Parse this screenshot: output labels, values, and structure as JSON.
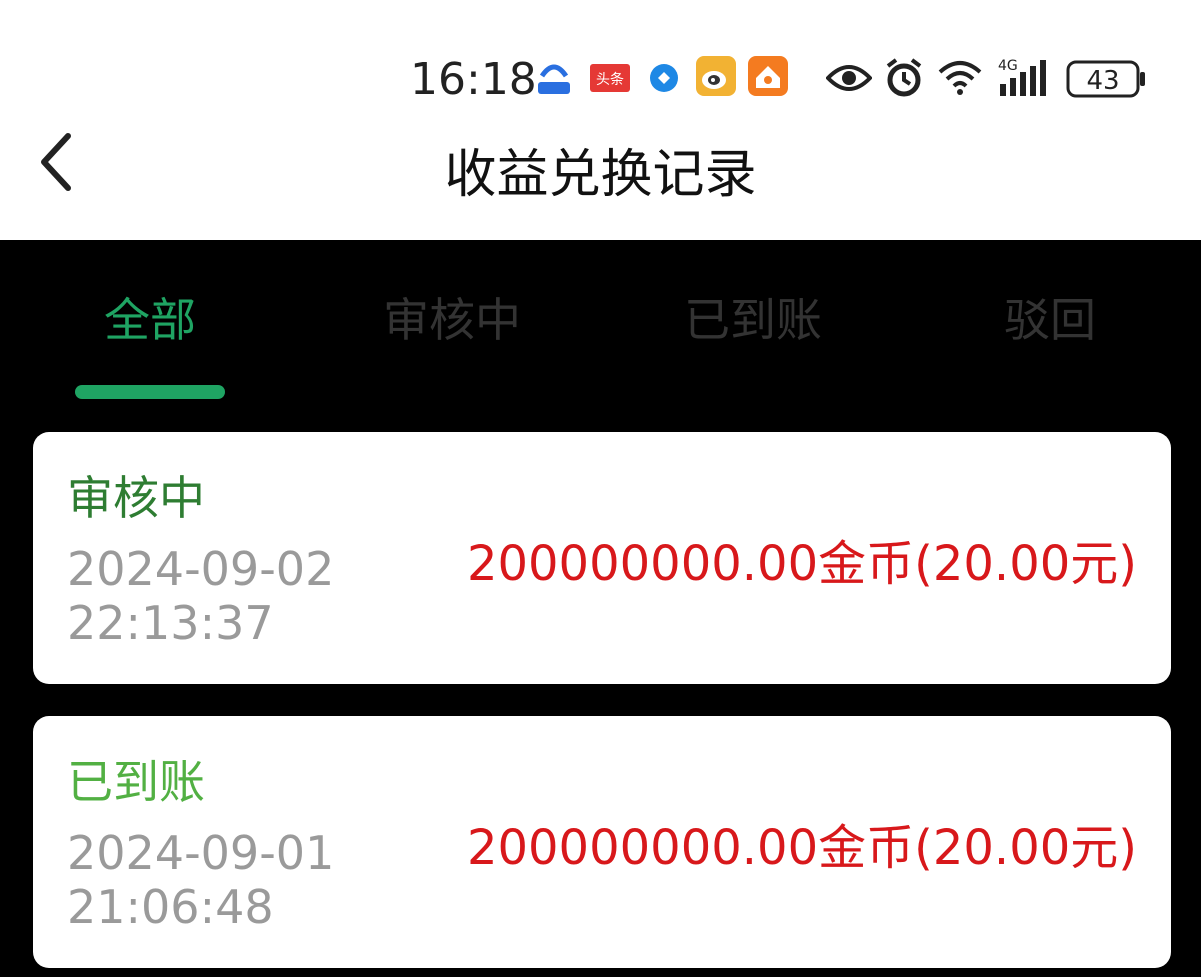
{
  "status_bar": {
    "time": "16:18",
    "battery": "43",
    "network": "4G",
    "icons": [
      "baidu-app-icon",
      "toutiao-app-icon",
      "browser-app-icon",
      "weibo-app-icon",
      "home-app-icon",
      "eye-icon",
      "alarm-icon",
      "wifi-icon",
      "signal-icon",
      "battery-icon"
    ],
    "toutiao_label": "头条"
  },
  "header": {
    "title": "收益兑换记录",
    "back_icon": "chevron-left-icon"
  },
  "tabs": [
    {
      "label": "全部",
      "active": true
    },
    {
      "label": "审核中",
      "active": false
    },
    {
      "label": "已到账",
      "active": false
    },
    {
      "label": "驳回",
      "active": false
    }
  ],
  "records": [
    {
      "status": "审核中",
      "status_color": "#2e7d32",
      "date": "2024-09-02",
      "time": "22:13:37",
      "amount": "200000000.00金币(20.00元)"
    },
    {
      "status": "已到账",
      "status_color": "#52b043",
      "date": "2024-09-01",
      "time": "21:06:48",
      "amount": "200000000.00金币(20.00元)"
    }
  ],
  "colors": {
    "accent": "#1fa463",
    "amount": "#d8181b",
    "background": "#000000"
  }
}
